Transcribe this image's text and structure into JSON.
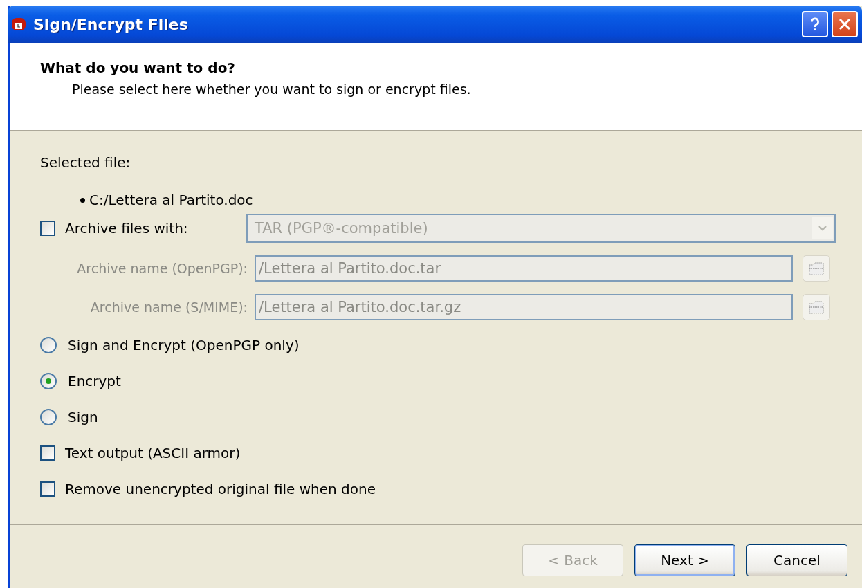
{
  "window": {
    "title": "Sign/Encrypt Files"
  },
  "header": {
    "heading": "What do you want to do?",
    "subtitle": "Please select here whether you want to sign or encrypt files."
  },
  "selected_file_label": "Selected file:",
  "files": [
    "C:/Lettera al Partito.doc"
  ],
  "archive": {
    "label": "Archive files with:",
    "checked": false,
    "format": "TAR (PGP®-compatible)",
    "disabled": true
  },
  "archive_names": [
    {
      "label": "Archive name (OpenPGP):",
      "value": "/Lettera al Partito.doc.tar",
      "disabled": true
    },
    {
      "label": "Archive name (S/MIME):",
      "value": "/Lettera al Partito.doc.tar.gz",
      "disabled": true
    }
  ],
  "options": [
    {
      "kind": "radio",
      "label": "Sign and Encrypt (OpenPGP only)",
      "selected": false
    },
    {
      "kind": "radio",
      "label": "Encrypt",
      "selected": true
    },
    {
      "kind": "radio",
      "label": "Sign",
      "selected": false
    },
    {
      "kind": "checkbox",
      "label": "Text output (ASCII armor)",
      "checked": false
    },
    {
      "kind": "checkbox",
      "label": "Remove unencrypted original file when done",
      "checked": false
    }
  ],
  "buttons": [
    {
      "label": "< Back",
      "disabled": true,
      "default": false
    },
    {
      "label": "Next >",
      "disabled": false,
      "default": true
    },
    {
      "label": "Cancel",
      "disabled": false,
      "default": false
    }
  ]
}
